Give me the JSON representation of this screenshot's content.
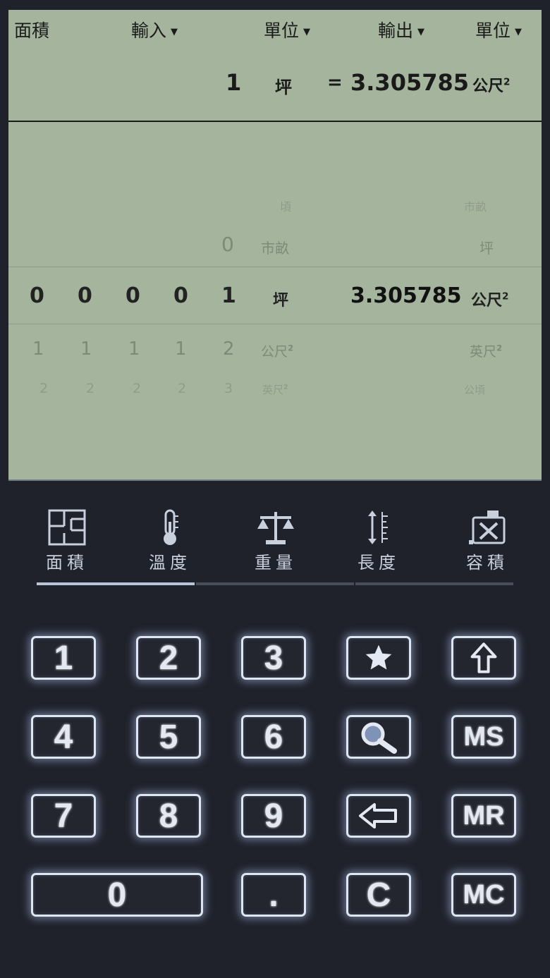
{
  "header": {
    "category": "面積",
    "input": "輸入",
    "unit_in": "單位",
    "output": "輸出",
    "unit_out": "單位",
    "dropdown_arrow": "▼"
  },
  "result": {
    "value": "1",
    "unit": "坪",
    "equals": "=",
    "output_value": "3.305785",
    "output_unit": "公尺",
    "output_unit_exp": "2"
  },
  "picker": {
    "row_m2": {
      "digits": [
        "",
        "",
        "",
        "",
        ""
      ],
      "unit": "頃",
      "out_unit": "市畝"
    },
    "row_m1": {
      "digits": [
        "",
        "",
        "",
        "",
        "0"
      ],
      "unit": "市畝",
      "out_unit": "坪"
    },
    "row_0": {
      "digits": [
        "0",
        "0",
        "0",
        "0",
        "1"
      ],
      "unit": "坪",
      "out_value": "3.305785",
      "out_unit": "公尺",
      "out_unit_exp": "2"
    },
    "row_p1": {
      "digits": [
        "1",
        "1",
        "1",
        "1",
        "2"
      ],
      "unit": "公尺",
      "unit_exp": "2",
      "out_unit": "英尺",
      "out_unit_exp": "2"
    },
    "row_p2": {
      "digits": [
        "2",
        "2",
        "2",
        "2",
        "3"
      ],
      "unit": "英尺",
      "unit_exp": "2",
      "out_unit": "公頃"
    }
  },
  "tabs": [
    {
      "label": "面積",
      "icon": "floorplan-icon",
      "active": true
    },
    {
      "label": "溫度",
      "icon": "thermometer-icon",
      "active": false
    },
    {
      "label": "重量",
      "icon": "scale-icon",
      "active": false
    },
    {
      "label": "長度",
      "icon": "ruler-icon",
      "active": false
    },
    {
      "label": "容積",
      "icon": "canister-icon",
      "active": false
    }
  ],
  "keys": {
    "k1": "1",
    "k2": "2",
    "k3": "3",
    "k4": "4",
    "k5": "5",
    "k6": "6",
    "k7": "7",
    "k8": "8",
    "k9": "9",
    "k0": "0",
    "dot": ".",
    "clear": "C",
    "ms": "MS",
    "mr": "MR",
    "mc": "MC"
  },
  "colors": {
    "lcd_background": "#a5b59d",
    "app_background": "#1f212b",
    "key_glow": "#dfe6f3"
  }
}
